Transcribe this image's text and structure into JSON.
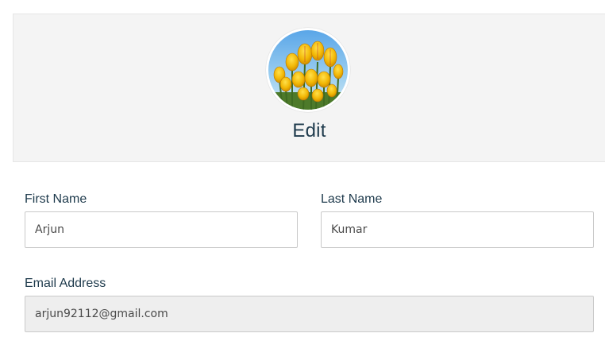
{
  "header": {
    "title": "Edit",
    "avatar_icon": "tulips-photo"
  },
  "form": {
    "first_name": {
      "label": "First Name",
      "value": "Arjun"
    },
    "last_name": {
      "label": "Last Name",
      "value": "Kumar"
    },
    "email": {
      "label": "Email Address",
      "value": "arjun92112@gmail.com"
    }
  },
  "colors": {
    "panel_background": "#f4f4f4",
    "label_text": "#1e3a4c",
    "readonly_background": "#eeeeee"
  }
}
